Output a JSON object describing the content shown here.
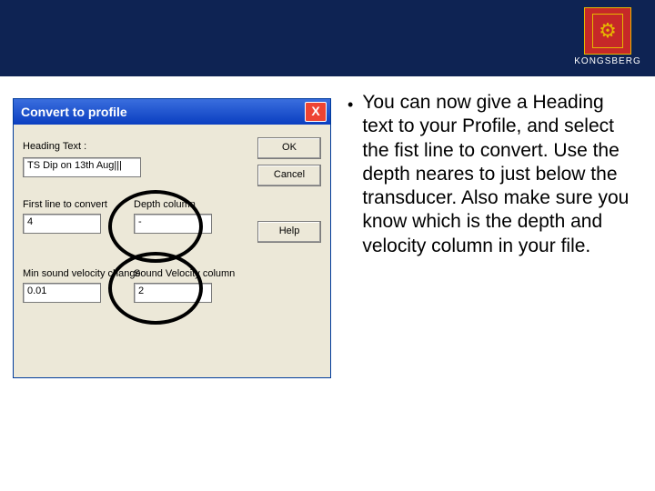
{
  "brand": {
    "name": "KONGSBERG"
  },
  "dialog": {
    "title": "Convert to profile",
    "close_glyph": "X",
    "labels": {
      "heading_text": "Heading Text :",
      "first_line": "First line to convert",
      "depth_col": "Depth column",
      "min_sv_chg": "Min sound velocity change",
      "sv_col": "Sound Velocity column"
    },
    "values": {
      "heading_text": "TS Dip on 13th Aug|||",
      "first_line": "4",
      "depth_col": "-",
      "min_sv_chg": "0.01",
      "sv_col": "2"
    },
    "buttons": {
      "ok": "OK",
      "cancel": "Cancel",
      "help": "Help"
    }
  },
  "paragraph": "You can now give a Heading text to your Profile, and select the fist line to convert. Use the depth neares to just below the transducer. Also make sure you know which is the depth and velocity column in your file."
}
